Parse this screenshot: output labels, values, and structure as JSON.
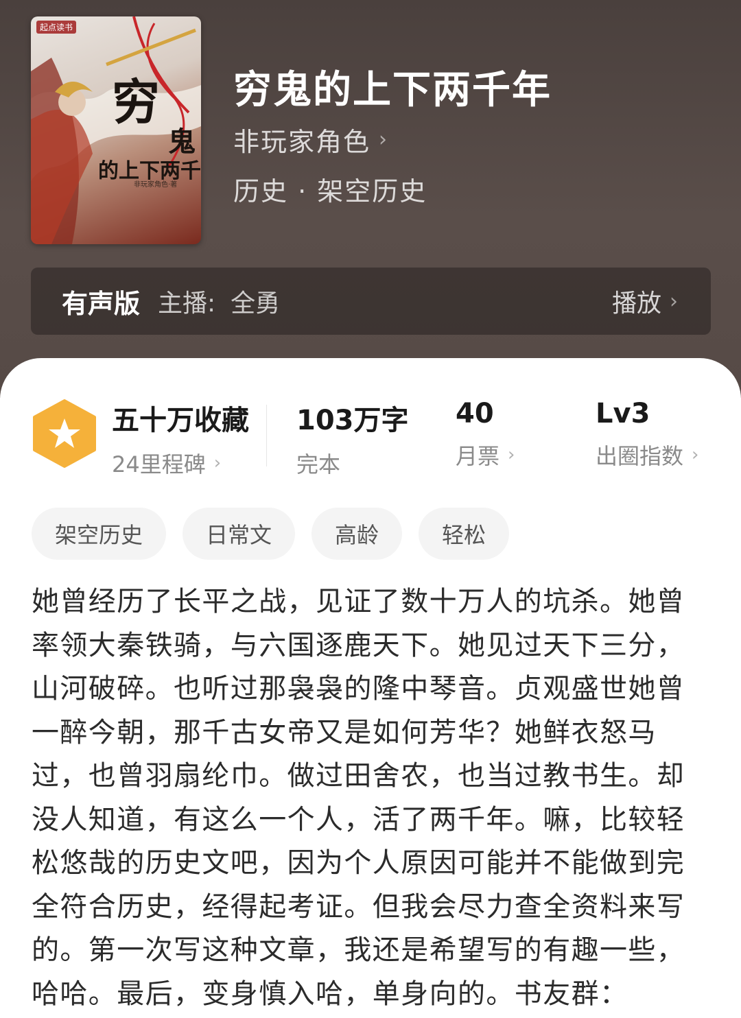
{
  "book": {
    "cover": {
      "brand": "起点读书",
      "title_char1": "穷",
      "title_char2": "鬼",
      "subtitle": "的上下两千年",
      "author": "非玩家角色·著"
    },
    "title": "穷鬼的上下两千年",
    "author": "非玩家角色",
    "genre": "历史 · 架空历史"
  },
  "audio": {
    "label": "有声版",
    "host_prefix": "主播:",
    "host_name": "全勇",
    "play_label": "播放"
  },
  "stats": {
    "badge_icon": "star-hexagon-icon",
    "badge_color": "#f5b13a",
    "favorites": "五十万收藏",
    "milestones": "24里程碑",
    "words": "103万字",
    "status": "完本",
    "monthly_votes_value": "40",
    "monthly_votes_label": "月票",
    "level_value": "Lv3",
    "level_label": "出圈指数"
  },
  "tags": [
    "架空历史",
    "日常文",
    "高龄",
    "轻松"
  ],
  "description_lines": [
    "她曾经历了长平之战，见证了数十万人的坑杀。她曾",
    "率领大秦铁骑，与六国逐鹿天下。她见过天下三分，",
    "山河破碎。也听过那袅袅的隆中琴音。贞观盛世她曾",
    "一醉今朝，那千古女帝又是如何芳华？她鲜衣怒马",
    "过，也曾羽扇纶巾。做过田舍农，也当过教书生。却",
    "没人知道，有这么一个人，活了两千年。嘛，比较轻",
    "松悠哉的历史文吧，因为个人原因可能并不能做到完",
    "全符合历史，经得起考证。但我会尽力查全资料来写",
    "的。第一次写这种文章，我还是希望写的有趣一些，",
    "哈哈。最后，变身慎入哈，单身向的。书友群："
  ]
}
